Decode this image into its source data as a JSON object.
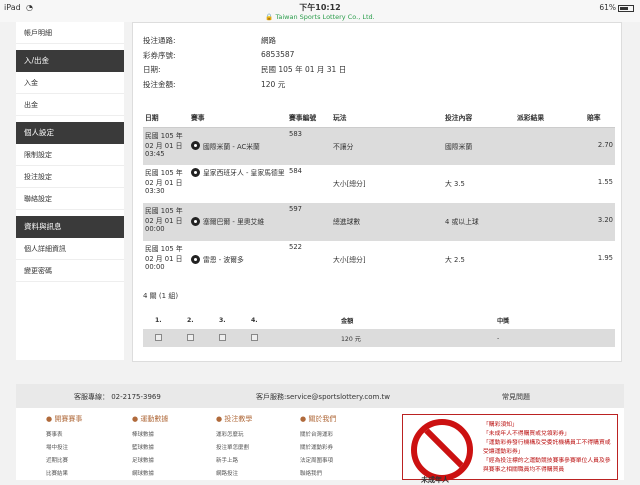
{
  "status_bar": {
    "device": "iPad",
    "time": "下午10:12",
    "site": "Taiwan Sports Lottery Co., Ltd.",
    "battery": "61%"
  },
  "sidebar": {
    "top_link": "帳戶明細",
    "sections": [
      {
        "title": "入/出金",
        "items": [
          "入金",
          "出金"
        ]
      },
      {
        "title": "個人設定",
        "items": [
          "限制設定",
          "投注設定",
          "聯絡設定"
        ]
      },
      {
        "title": "資料與訊息",
        "items": [
          "個人詳細資訊",
          "變更密碼"
        ]
      }
    ]
  },
  "info": [
    {
      "k": "投注通路:",
      "v": "網路"
    },
    {
      "k": "彩券序號:",
      "v": "6853587"
    },
    {
      "k": "日期:",
      "v": "民國 105 年 01 月 31 日"
    },
    {
      "k": "投注金額:",
      "v": "120 元"
    }
  ],
  "bets": {
    "headers": [
      "日期",
      "賽事",
      "賽事編號",
      "玩法",
      "投注內容",
      "派彩結果",
      "賠率"
    ],
    "rows": [
      {
        "date": "民國 105 年 02 月 01 日 03:45",
        "event": "國際米蘭 - AC米蘭",
        "id": "583",
        "play": "不讓分",
        "pick": "國際米蘭",
        "result": "",
        "odds": "2.70"
      },
      {
        "date": "民國 105 年 02 月 01 日 03:30",
        "event": "皇家西班牙人 - 皇家馬德里",
        "id": "584",
        "play": "大小[總分]",
        "pick": "大 3.5",
        "result": "",
        "odds": "1.55"
      },
      {
        "date": "民國 105 年 02 月 01 日 00:00",
        "event": "塞爾巴爾 - 里奧艾維",
        "id": "597",
        "play": "總進球數",
        "pick": "4 或以上球",
        "result": "",
        "odds": "3.20"
      },
      {
        "date": "民國 105 年 02 月 01 日 00:00",
        "event": "雷恩 - 波爾多",
        "id": "522",
        "play": "大小[總分]",
        "pick": "大 2.5",
        "result": "",
        "odds": "1.95"
      }
    ]
  },
  "summary": "4 關 (1 組)",
  "combo": {
    "headers": [
      "1.",
      "2.",
      "3.",
      "4.",
      "金額",
      "中獎"
    ],
    "amount": "120 元",
    "win": "-"
  },
  "footer": {
    "hotline": "客服專線：  02-2175-3969",
    "email": "客戶服務:service@sportslottery.com.tw",
    "faq": "常見問題",
    "cols": [
      {
        "title": "開賽賽事",
        "items": [
          "賽事表",
          "場中投注",
          "近期比賽",
          "比賽結果"
        ]
      },
      {
        "title": "運動數據",
        "items": [
          "棒球數據",
          "籃球數據",
          "足球數據",
          "網球數據"
        ]
      },
      {
        "title": "投注教學",
        "items": [
          "運彩怎麼玩",
          "投注單怎麼劃",
          "新手上路",
          "網路投注"
        ]
      },
      {
        "title": "關於我們",
        "items": [
          "關於台灣運彩",
          "關於運動彩券",
          "法定周圍事項",
          "聯絡我們"
        ]
      }
    ],
    "sign_label": "未成年人",
    "notice": [
      "「購彩須知」",
      "「未成年人不得購買或兌領彩券」",
      "「運動彩券發行機構及受委託機構員工不得購買或受讓運動彩券」",
      "「經為投注標的之運動競技賽事參賽單位人員及參與賽事之相關職員均不得購買員"
    ]
  }
}
